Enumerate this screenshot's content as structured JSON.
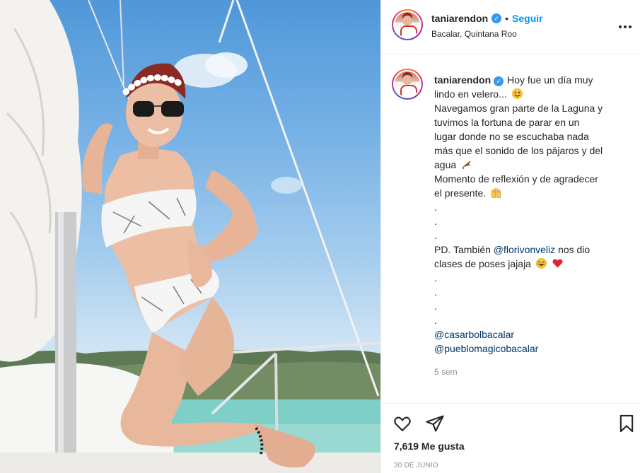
{
  "post": {
    "username": "taniarendon",
    "follow_label": "Seguir",
    "separator": "•",
    "location": "Bacalar, Quintana Roo",
    "caption": {
      "l1": "Hoy fue un día muy",
      "l2": "lindo en velero...",
      "l3": "Navegamos gran parte de la Laguna y",
      "l4": "tuvimos la fortuna de parar en un",
      "l5": "lugar donde no se escuchaba nada",
      "l6": "más que el sonido de los pájaros y del",
      "l7": "agua",
      "l8": "Momento de reflexión y de agradecer",
      "l9": "el presente.",
      "dot": ".",
      "ps_prefix": "PD. También",
      "ps_mention": "@florivonveliz",
      "ps_suffix": "nos dio",
      "ps_l2": "clases de poses jajaja",
      "tag1": "@casarbolbacalar",
      "tag2": "@pueblomagicobacalar"
    },
    "time_ago": "5 sem",
    "likes": "7,619 Me gusta",
    "date": "30 DE JUNIO"
  },
  "colors": {
    "link": "#0095f6",
    "mention": "#00376b",
    "verified": "#3897f0",
    "heart": "#ed4956"
  },
  "icons": {
    "verified": "verified-badge-icon",
    "more": "more-options-icon",
    "like": "heart-icon",
    "share": "paper-plane-icon",
    "save": "bookmark-icon"
  }
}
